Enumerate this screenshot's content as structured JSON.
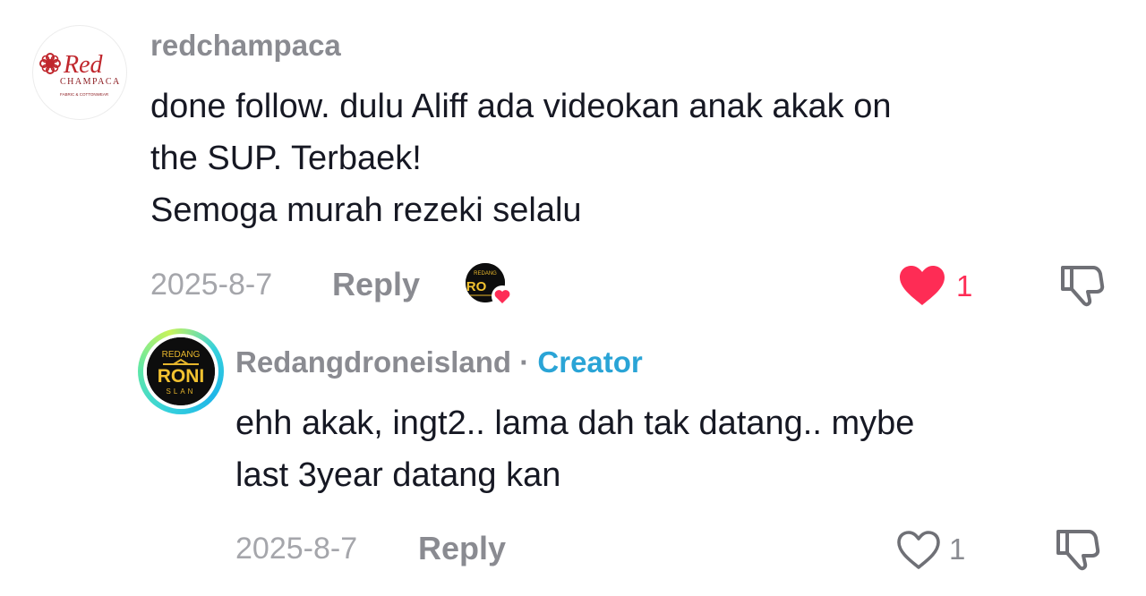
{
  "comments": [
    {
      "username": "redchampaca",
      "avatar": {
        "brand": "Red",
        "brand_sub": "CHAMPACA",
        "tagline": "FABRIC & COTTONWEAR",
        "flower_icon": "flower-icon"
      },
      "text": "done follow. dulu Aliff ada videokan anak akak on\nthe SUP. Terbaek!\nSemoga murah rezeki selalu",
      "date": "2025-8-7",
      "reply_label": "Reply",
      "like_count": "1",
      "liked": true,
      "liked_by_creator": true,
      "like_color": "#fe2c55"
    },
    {
      "username": "Redangdroneisland",
      "separator": "·",
      "badge": "Creator",
      "avatar": {
        "top_text": "REDANG",
        "main_text": "RONI",
        "bottom_text": "SLAN"
      },
      "text": "ehh akak, ingt2.. lama dah tak datang.. mybe\nlast 3year datang kan",
      "date": "2025-8-7",
      "reply_label": "Reply",
      "like_count": "1",
      "liked": false
    }
  ],
  "liked_by_avatar": {
    "top_text": "REDANG",
    "main_text": "RO"
  },
  "colors": {
    "accent_heart": "#fe2c55",
    "creator_badge": "#2aa4d6",
    "muted_text": "#8a8b91"
  }
}
